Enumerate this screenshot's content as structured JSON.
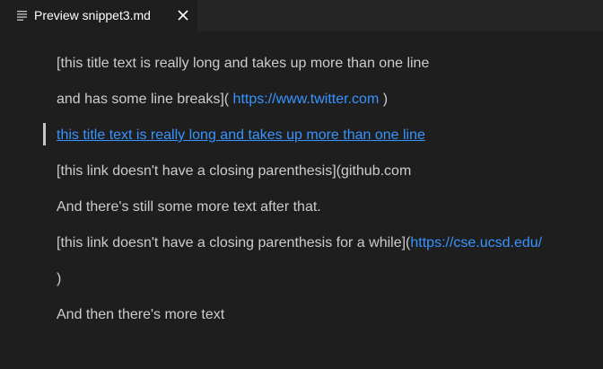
{
  "tab": {
    "title": "Preview snippet3.md",
    "icon": "preview-icon",
    "close_icon": "close-icon"
  },
  "preview": {
    "lines": [
      {
        "text": "[this title text is really long and takes up more than one line"
      },
      {
        "before": "and has some line breaks](",
        "link": " https://www.twitter.com ",
        "after": ")"
      },
      {
        "link": "this title text is really long and takes up more than one line"
      },
      {
        "text": "[this link doesn't have a closing parenthesis](github.com"
      },
      {
        "text": "And there's still some more text after that."
      },
      {
        "before": "[this link doesn't have a closing parenthesis for a while](",
        "link": "https://cse.ucsd.edu/"
      },
      {
        "text": ")"
      },
      {
        "text": "And then there's more text"
      }
    ]
  },
  "colors": {
    "background": "#1e1e1e",
    "tabbar": "#252526",
    "text": "#cccccc",
    "link": "#3794ff"
  }
}
